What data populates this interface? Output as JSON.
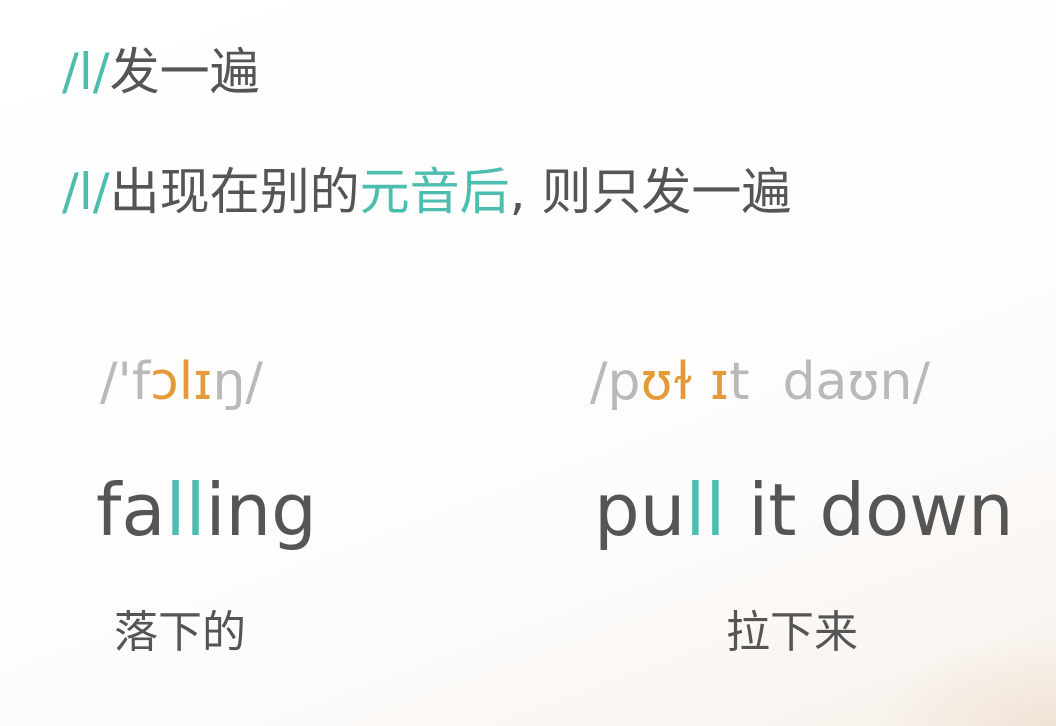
{
  "rules": [
    {
      "parts": [
        {
          "text": "/l/",
          "color": "teal"
        },
        {
          "text": "发一遍",
          "color": "gray"
        }
      ]
    },
    {
      "parts": [
        {
          "text": "/l/",
          "color": "teal"
        },
        {
          "text": "出现在别的",
          "color": "gray"
        },
        {
          "text": "元音后",
          "color": "teal"
        },
        {
          "text": ", 则只发一遍",
          "color": "gray"
        }
      ]
    }
  ],
  "examples": [
    {
      "ipa": [
        {
          "text": "/'f",
          "color": "gray"
        },
        {
          "text": "ɔlɪ",
          "color": "orange"
        },
        {
          "text": "ŋ/",
          "color": "gray"
        }
      ],
      "word": [
        {
          "text": "fa",
          "color": "gray"
        },
        {
          "text": "ll",
          "color": "teal"
        },
        {
          "text": "ing",
          "color": "gray"
        }
      ],
      "meaning": "落下的"
    },
    {
      "ipa": [
        {
          "text": "/p",
          "color": "gray"
        },
        {
          "text": "ʊɫ ɪ",
          "color": "orange"
        },
        {
          "text": "t  daʊn/",
          "color": "gray"
        }
      ],
      "word": [
        {
          "text": "pu",
          "color": "gray"
        },
        {
          "text": "ll",
          "color": "teal"
        },
        {
          "text": " it down",
          "color": "gray"
        }
      ],
      "meaning": "拉下来"
    }
  ],
  "colors": {
    "teal": "#4dbdaf",
    "orange": "#e59a3a",
    "gray": "#555555",
    "light_gray": "#b9b9b9"
  }
}
